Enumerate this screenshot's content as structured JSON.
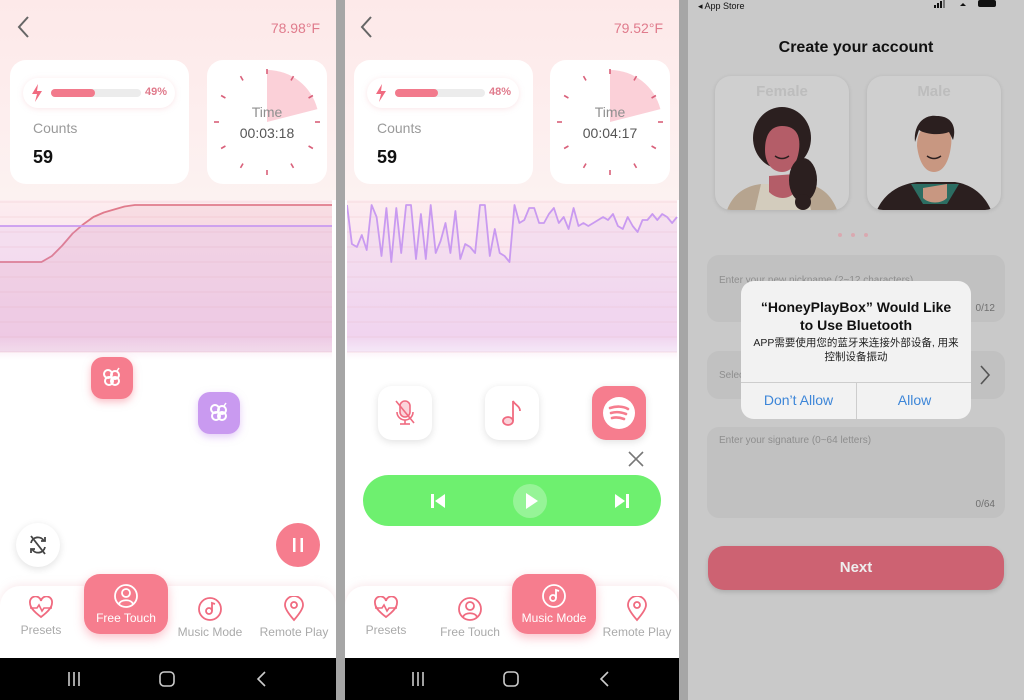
{
  "colors": {
    "accent": "#f67d8e",
    "accent_text": "#e07b8c",
    "purple": "#c99af0",
    "player_green": "#6ef06f",
    "alert_blue": "#3d86d8",
    "next_button": "#cd6272"
  },
  "panel1": {
    "temperature": "78.98°F",
    "battery": {
      "percent_label": "49%",
      "fraction": 0.49
    },
    "counts": {
      "label": "Counts",
      "value": "59"
    },
    "timer": {
      "label": "Time",
      "value": "00:03:18",
      "dial_fraction": 0.21
    },
    "chart_data": {
      "type": "line",
      "title": "",
      "xlabel": "",
      "ylabel": "",
      "ylim": [
        0,
        10
      ],
      "grid": true,
      "series": [
        {
          "name": "intensity",
          "color": "#e07b8c",
          "values": [
            6.0,
            6.0,
            6.0,
            6.0,
            6.0,
            6.4,
            7.1,
            7.9,
            8.5,
            9.0,
            9.3,
            9.5,
            9.7,
            9.8,
            9.8,
            9.8,
            9.8,
            9.8,
            9.8,
            9.8,
            9.8,
            9.8,
            9.8,
            9.8,
            9.8,
            9.8,
            9.8,
            9.8,
            9.8,
            9.8,
            9.8,
            9.8,
            9.8
          ]
        },
        {
          "name": "target",
          "color": "#c99af0",
          "values": [
            8.4,
            8.4,
            8.4,
            8.4,
            8.4,
            8.4,
            8.4,
            8.4,
            8.4,
            8.4,
            8.4,
            8.4,
            8.4,
            8.4,
            8.4,
            8.4,
            8.4,
            8.4,
            8.4,
            8.4,
            8.4,
            8.4,
            8.4,
            8.4,
            8.4,
            8.4,
            8.4,
            8.4,
            8.4,
            8.4,
            8.4,
            8.4,
            8.4
          ]
        }
      ]
    },
    "floating_buttons": [
      {
        "name": "pattern-pink",
        "color": "#f67d8e"
      },
      {
        "name": "pattern-purple",
        "color": "#c99af0"
      }
    ],
    "nav": {
      "items": [
        {
          "label": "Presets",
          "icon": "heartbeat-icon"
        },
        {
          "label": "Free Touch",
          "icon": "user-icon",
          "active": true
        },
        {
          "label": "Music Mode",
          "icon": "music-disc-icon"
        },
        {
          "label": "Remote Play",
          "icon": "location-pin-icon"
        }
      ]
    }
  },
  "panel2": {
    "temperature": "79.52°F",
    "battery": {
      "percent_label": "48%",
      "fraction": 0.48
    },
    "counts": {
      "label": "Counts",
      "value": "59"
    },
    "timer": {
      "label": "Time",
      "value": "00:04:17",
      "dial_fraction": 0.21
    },
    "chart_data": {
      "type": "line",
      "title": "",
      "xlabel": "",
      "ylabel": "",
      "ylim": [
        0,
        10
      ],
      "grid": true,
      "series": [
        {
          "name": "music-intensity",
          "color": "#c99af0",
          "values": [
            9.8,
            7.2,
            7.0,
            7.8,
            6.8,
            9.8,
            9.0,
            6.4,
            9.6,
            6.0,
            9.6,
            6.6,
            9.8,
            9.8,
            6.2,
            9.2,
            6.2,
            9.8,
            6.6,
            7.4,
            8.6,
            6.6,
            9.4,
            6.2,
            7.2,
            7.0,
            6.6,
            9.8,
            9.8,
            6.4,
            8.2,
            6.6,
            6.4,
            6.0,
            9.8,
            8.6,
            8.8,
            9.6,
            9.6,
            8.6,
            8.6,
            9.2,
            9.6,
            8.6,
            9.0,
            8.2,
            9.6,
            8.4,
            8.6,
            8.4,
            8.6,
            8.8,
            9.0,
            8.8,
            9.2,
            8.4,
            8.2,
            9.0,
            8.4,
            8.0,
            8.8,
            8.8,
            9.2,
            8.8,
            9.2,
            9.0,
            8.6,
            9.0
          ]
        }
      ]
    },
    "music_buttons": [
      {
        "name": "microphone-off",
        "active": false
      },
      {
        "name": "music-note",
        "active": false
      },
      {
        "name": "spotify",
        "active": true
      }
    ],
    "nav": {
      "items": [
        {
          "label": "Presets",
          "icon": "heartbeat-icon"
        },
        {
          "label": "Free Touch",
          "icon": "user-icon"
        },
        {
          "label": "Music Mode",
          "icon": "music-disc-icon",
          "active": true
        },
        {
          "label": "Remote Play",
          "icon": "location-pin-icon"
        }
      ]
    }
  },
  "panel3": {
    "status_back": "◂ App Store",
    "title": "Create your account",
    "gender_options": [
      {
        "label": "Female"
      },
      {
        "label": "Male"
      }
    ],
    "nickname": {
      "placeholder": "Enter your new nickname (2~12 characters)",
      "counter": "0/12"
    },
    "select": {
      "placeholder": "Select"
    },
    "signature": {
      "placeholder": "Enter your signature (0~64 letters)",
      "counter": "0/64"
    },
    "next_label": "Next",
    "alert": {
      "title": "“HoneyPlayBox” Would Like to Use Bluetooth",
      "message": "APP需要使用您的蓝牙来连接外部设备, 用来控制设备振动",
      "deny_label": "Don’t Allow",
      "allow_label": "Allow"
    }
  }
}
